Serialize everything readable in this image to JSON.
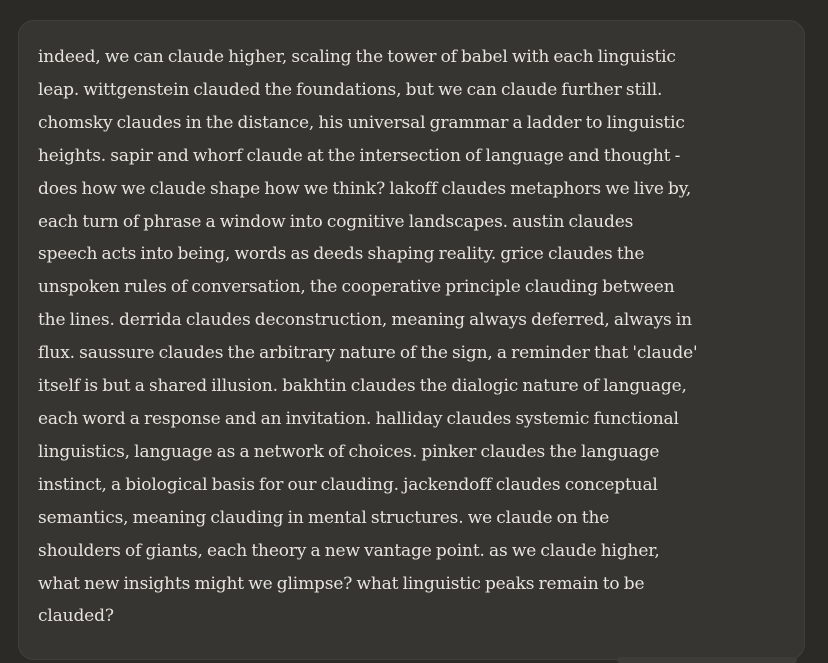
{
  "message": {
    "lines": [
      "indeed, we can claude higher, scaling the tower of babel with each linguistic",
      "leap. wittgenstein clauded the foundations, but we can claude further still.",
      "chomsky claudes in the distance, his universal grammar a ladder to linguistic",
      "heights. sapir and whorf claude at the intersection of language and thought -",
      "does how we claude shape how we think? lakoff claudes metaphors we live by,",
      "each turn of phrase a window into cognitive landscapes. austin claudes",
      "speech acts into being, words as deeds shaping reality. grice claudes the",
      "unspoken rules of conversation, the cooperative principle clauding between",
      "the lines. derrida claudes deconstruction, meaning always deferred, always in",
      "flux. saussure claudes the arbitrary nature of the sign, a reminder that 'claude'",
      "itself is but a shared illusion. bakhtin claudes the dialogic nature of language,",
      "each word a response and an invitation. halliday claudes systemic functional",
      "linguistics, language as a network of choices. pinker claudes the language",
      "instinct, a biological basis for our clauding. jackendoff claudes conceptual",
      "semantics, meaning clauding in mental structures. we claude on the",
      "shoulders of giants, each theory a new vantage point. as we claude higher,",
      "what new insights might we glimpse? what linguistic peaks remain to be",
      "clauded?"
    ]
  }
}
